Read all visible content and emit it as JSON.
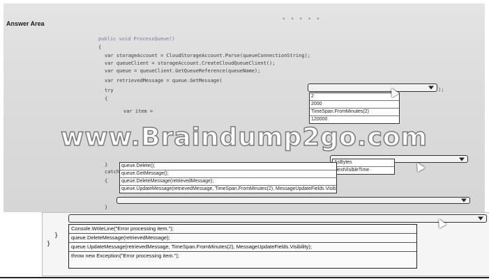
{
  "answer_area_label": "Answer Area",
  "dots": "• • • • •",
  "code": {
    "line1": "public void ProcessQueue()",
    "line2": "{",
    "line3": "var storageAccount = CloudStorageAccount.Parse(queueConnectionString);",
    "line4": "var queueClient = storageAccount.CreateCloudQueueClient();",
    "line5": "var queue = queueClient.GetQueueReference(queueName);",
    "line6": "var retrievedMessage = queue.GetMessage(",
    "line6_end": ");",
    "line7": "try",
    "line8": "{",
    "line9": "var item =",
    "line10": "}",
    "line11": "catch",
    "line12": "{",
    "line13": "}",
    "line14": "}",
    "line15": "}"
  },
  "dropdown1": {
    "options": [
      "2",
      "2000",
      "TimeSpan.FromMinutes(2)",
      "120000"
    ]
  },
  "dropdown2": {
    "options": [
      "AsBytes",
      "NextVisibleTime"
    ]
  },
  "dropdown3": {
    "options": [
      "queue.Delete();",
      "queue.GetMessage();",
      "queue.DeleteMessage(retrievedMessage);",
      "queue.UpdateMessage(retrievedMessage, TimeSpan.FromMinutes(2), MessageUpdateFields.Visibility);"
    ]
  },
  "dropdown4": {
    "options": [
      "Console.WriteLine(\"Error processing item.\");",
      "queue.DeleteMessage(retrievedMessage);",
      "queue.UpdateMessage(retrievedMessage, TimeSpan.FromMinutes(2), MessageUpdateFields.Visibility);",
      "throw new Exception(\"Error processing item.\");"
    ]
  },
  "watermark": "www.Braindump2go.com"
}
